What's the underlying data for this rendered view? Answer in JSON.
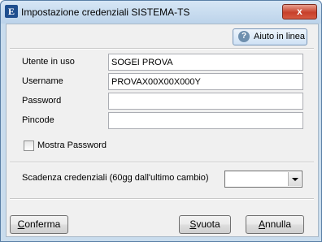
{
  "window": {
    "title": "Impostazione credenziali SISTEMA-TS",
    "app_icon": "E",
    "close_glyph": "x"
  },
  "help": {
    "label": "Aiuto in linea",
    "icon": "?"
  },
  "fields": {
    "utente": {
      "label": "Utente in uso",
      "value": "SOGEI PROVA"
    },
    "username": {
      "label": "Username",
      "value": "PROVAX00X00X000Y"
    },
    "password": {
      "label": "Password",
      "value": ""
    },
    "pincode": {
      "label": "Pincode",
      "value": ""
    }
  },
  "show_password": {
    "label": "Mostra Password",
    "checked": false
  },
  "scadenza": {
    "label": "Scadenza credenziali (60gg dall'ultimo cambio)",
    "value": ""
  },
  "buttons": {
    "conferma": {
      "first": "C",
      "rest": "onferma"
    },
    "svuota": {
      "first": "S",
      "rest": "vuota"
    },
    "annulla": {
      "first": "A",
      "rest": "nnulla"
    }
  }
}
